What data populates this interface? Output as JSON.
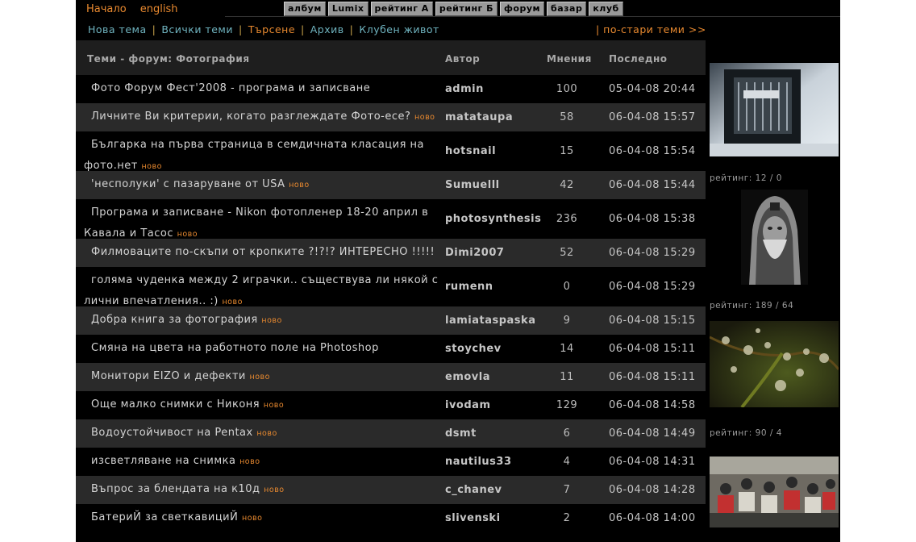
{
  "top_nav": [
    "Начало",
    "english"
  ],
  "top_links": [
    "албум",
    "Lumix",
    "рейтинг А",
    "рейтинг Б",
    "форум",
    "базар",
    "клуб"
  ],
  "sub_nav": [
    {
      "label": "Нова тема",
      "active": false
    },
    {
      "label": "Всички теми",
      "active": false
    },
    {
      "label": "Търсене",
      "active": true
    },
    {
      "label": "Архив",
      "active": false
    },
    {
      "label": "Клубен живот",
      "active": false
    }
  ],
  "older_link": "| по-стари теми >>",
  "table": {
    "headers": {
      "topic": "Теми - форум: Фотография",
      "author": "Автор",
      "posts": "Мнения",
      "last": "Последно"
    },
    "new_label": "ново",
    "rows": [
      {
        "topic": "Фото Форум Фест'2008 - програма и записване",
        "new": false,
        "author": "admin",
        "posts": "100",
        "last": "05-04-08 20:44"
      },
      {
        "topic": "Личните Ви критерии, когато разглеждате Фото-есе?",
        "new": true,
        "author": "matataupa",
        "posts": "58",
        "last": "06-04-08 15:57"
      },
      {
        "topic": "Българка на първа страница в семдичната класация на фото.нет",
        "new": true,
        "author": "hotsnail",
        "posts": "15",
        "last": "06-04-08 15:54"
      },
      {
        "topic": "'несполуки' с пазаруване от USA",
        "new": true,
        "author": "Sumuelll",
        "posts": "42",
        "last": "06-04-08 15:44"
      },
      {
        "topic": "Програма и записване - Nikon фотопленер 18-20 април в Кавала и Тасос",
        "new": true,
        "author": "photosynthesis",
        "posts": "236",
        "last": "06-04-08 15:38"
      },
      {
        "topic": "Филмоваците по-скъпи от кропките ?!?!? ИНТЕРЕСНО !!!!!",
        "new": true,
        "author": "Dimi2007",
        "posts": "52",
        "last": "06-04-08 15:29"
      },
      {
        "topic": "голяма чуденка между 2 играчки.. съществува ли някой с лични впечатления.. :)",
        "new": true,
        "author": "rumenn",
        "posts": "0",
        "last": "06-04-08 15:29"
      },
      {
        "topic": "Добра книга за фотография",
        "new": true,
        "author": "lamiataspaska",
        "posts": "9",
        "last": "06-04-08 15:15"
      },
      {
        "topic": "Смяна на цвета на работното поле на Photoshop",
        "new": false,
        "author": "stoychev",
        "posts": "14",
        "last": "06-04-08 15:11"
      },
      {
        "topic": "Монитори EIZO и дефекти",
        "new": true,
        "author": "emovla",
        "posts": "11",
        "last": "06-04-08 15:11"
      },
      {
        "topic": "Още малко снимки с Никоня",
        "new": true,
        "author": "ivodam",
        "posts": "129",
        "last": "06-04-08 14:58"
      },
      {
        "topic": "Водоустойчивост на Pentax",
        "new": true,
        "author": "dsmt",
        "posts": "6",
        "last": "06-04-08 14:49"
      },
      {
        "topic": "изсветляване на снимка",
        "new": true,
        "author": "nautilus33",
        "posts": "4",
        "last": "06-04-08 14:31"
      },
      {
        "topic": "Въпрос за блендата на к10д",
        "new": true,
        "author": "c_chanev",
        "posts": "7",
        "last": "06-04-08 14:28"
      },
      {
        "topic": "БатериЙ за светкавициЙ",
        "new": true,
        "author": "slivenski",
        "posts": "2",
        "last": "06-04-08 14:00"
      }
    ]
  },
  "sidebar": {
    "ratings": [
      "рейтинг: 12 / 0",
      "рейтинг: 189 / 64",
      "рейтинг: 90 / 4"
    ],
    "thumbs": [
      "photo-architecture",
      "photo-old-man-portrait",
      "photo-water-drops",
      "photo-scooter-crowd"
    ]
  }
}
